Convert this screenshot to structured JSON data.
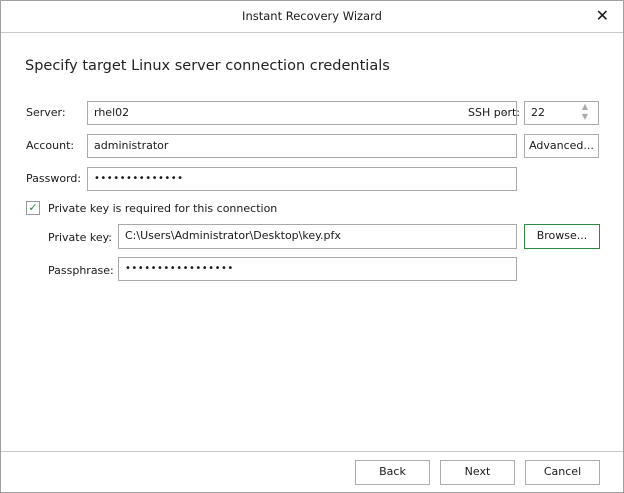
{
  "window": {
    "title": "Instant Recovery Wizard"
  },
  "heading": "Specify target Linux server connection credentials",
  "server": {
    "label": "Server:",
    "value": "rhel02"
  },
  "ssh_port": {
    "label": "SSH port:",
    "value": "22"
  },
  "account": {
    "label": "Account:",
    "value": "administrator",
    "button": "Advanced..."
  },
  "password": {
    "label": "Password:",
    "value": "••••••••••••••"
  },
  "private_key_checkbox": {
    "label": "Private key is required for this connection",
    "checked": true
  },
  "private_key": {
    "label": "Private key:",
    "value": "C:\\Users\\Administrator\\Desktop\\key.pfx",
    "button": "Browse..."
  },
  "passphrase": {
    "label": "Passphrase:",
    "value": "•••••••••••••••••"
  },
  "footer": {
    "back": "Back",
    "next": "Next",
    "cancel": "Cancel"
  }
}
